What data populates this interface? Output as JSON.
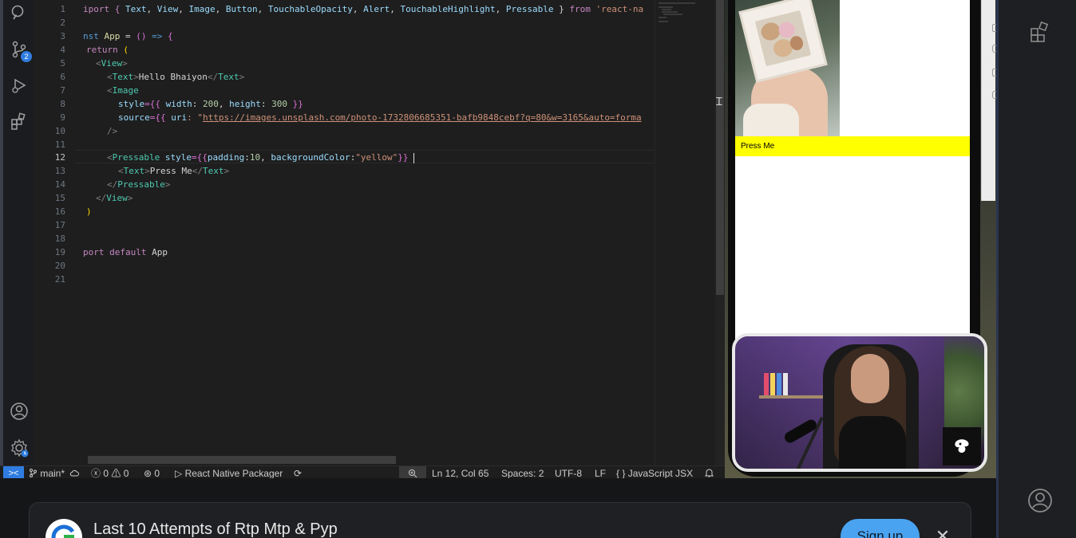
{
  "editor": {
    "line_numbers": [
      "1",
      "2",
      "3",
      "4",
      "5",
      "6",
      "7",
      "8",
      "9",
      "10",
      "11",
      "12",
      "13",
      "14",
      "15",
      "16",
      "17",
      "18",
      "19",
      "20",
      "21"
    ],
    "active_line": "12",
    "lines": {
      "l1": {
        "a": "iport { ",
        "b": "Text",
        "c": ", ",
        "d": "View",
        "e": ", ",
        "f": "Image",
        "g": ", ",
        "h": "Button",
        "i": ", ",
        "j": "TouchableOpacity",
        "k": ", ",
        "l": "Alert",
        "m": ", ",
        "n": "TouchableHighlight",
        "o": ", ",
        "p": "Pressable",
        "q": " } ",
        "r": "from",
        "s": " 'react-na"
      },
      "l3": {
        "a": "nst ",
        "b": "App",
        "c": " = ",
        "d": "()",
        "e": " => ",
        "f": "{"
      },
      "l4": {
        "a": "return",
        "b": " ("
      },
      "l5": {
        "a": "<",
        "b": "View",
        "c": ">"
      },
      "l6": {
        "a": "<",
        "b": "Text",
        "c": ">",
        "d": "Hello Bhaiyon",
        "e": "</",
        "f": "Text",
        "g": ">"
      },
      "l7": {
        "a": "<",
        "b": "Image"
      },
      "l8": {
        "a": "style",
        "b": "={{ ",
        "c": "width",
        "d": ": ",
        "e": "200",
        "f": ", ",
        "g": "height",
        "h": ": ",
        "i": "300",
        "j": " }}"
      },
      "l9": {
        "a": "source",
        "b": "={{ ",
        "c": "uri",
        "d": ": \"",
        "e": "https://images.unsplash.com/photo-1732806685351-bafb9848cebf?q=80&w=3165&auto=forma"
      },
      "l10": {
        "a": "/>"
      },
      "l12": {
        "a": "<",
        "b": "Pressable",
        "c": " ",
        "d": "style",
        "e": "={{",
        "f": "padding",
        "g": ":",
        "h": "10",
        "i": ", ",
        "j": "backgroundColor",
        "k": ":",
        "l": "\"yellow\"",
        "m": "}} "
      },
      "l13": {
        "a": "<",
        "b": "Text",
        "c": ">",
        "d": "Press Me",
        "e": "</",
        "f": "Text",
        "g": ">"
      },
      "l14": {
        "a": "</",
        "b": "Pressable",
        "c": ">"
      },
      "l15": {
        "a": "</",
        "b": "View",
        "c": ">"
      },
      "l16": {
        "a": ")"
      },
      "l19": {
        "a": "port ",
        "b": "default",
        "c": " App"
      }
    }
  },
  "activity_bar": {
    "source_control_badge": "2"
  },
  "statusbar": {
    "remote": "><",
    "branch": "main*",
    "errors": "0",
    "warnings": "0",
    "ports": "0",
    "task": "React Native Packager",
    "cursor_pos": "Ln 12, Col 65",
    "indent": "Spaces: 2",
    "encoding": "UTF-8",
    "eol": "LF",
    "language": "JavaScript JSX"
  },
  "simulator": {
    "button_text": "Press Me",
    "button_color": "#ffff00"
  },
  "banner": {
    "title": "Last 10 Attempts of Rtp Mtp & Pyp",
    "signup_label": "Sign up",
    "close_glyph": "✕"
  },
  "colors": {
    "accent": "#2f7de1",
    "signup": "#4aa3f0",
    "editor_bg": "#1e1e1e"
  }
}
